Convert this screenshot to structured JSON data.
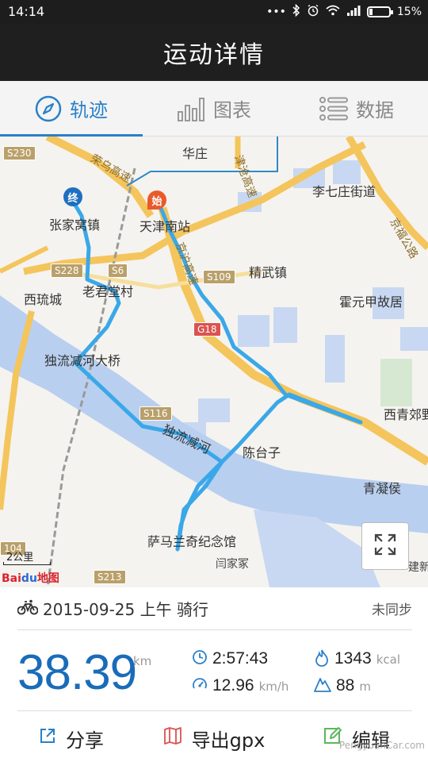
{
  "status_bar": {
    "time": "14:14",
    "dots": "•••",
    "battery_percent": "15%",
    "battery_level": 0.15
  },
  "header": {
    "title": "运动详情"
  },
  "tabs": [
    {
      "label": "轨迹",
      "icon": "compass-icon",
      "active": true
    },
    {
      "label": "图表",
      "icon": "bar-chart-icon",
      "active": false
    },
    {
      "label": "数据",
      "icon": "list-icon",
      "active": false
    }
  ],
  "map": {
    "labels": {
      "huazhuang": "华庄",
      "lqz": "李七庄街道",
      "zjw": "张家窝镇",
      "tjnz": "天津南站",
      "jwz": "精武镇",
      "xlc": "西琉城",
      "ljtc": "老君堂村",
      "hyj": "霍元甲故居",
      "dljdq": "独流减河大桥",
      "xqjy": "西青郊野",
      "dljh": "独流减河",
      "ctz": "陈台子",
      "qnh": "青凝侯",
      "smlq": "萨马兰奇纪念馆",
      "yjj": "闫家冢",
      "jx": "建新",
      "rongwu": "荣乌高速",
      "jincang": "津沧高速",
      "jinjin": "京沪高速",
      "jingwu_road": "京福公路"
    },
    "road_badges": {
      "s230": "S230",
      "s228": "S228",
      "s6": "S6",
      "s109": "S109",
      "g18": "G18",
      "s116": "S116",
      "s213": "S213",
      "s104": "104"
    },
    "markers": {
      "end": "终",
      "start": "始"
    },
    "scale": "2公里",
    "logo_bai": "Bai",
    "logo_du": "du",
    "logo_map": "地图"
  },
  "ride": {
    "date_label": "2015-09-25 上午 骑行",
    "sync_status": "未同步"
  },
  "stats": {
    "distance": "38.39",
    "distance_unit": "km",
    "duration": "2:57:43",
    "calories": "1343",
    "calories_unit": "kcal",
    "speed": "12.96",
    "speed_unit": "km/h",
    "climb": "88",
    "climb_unit": "m"
  },
  "actions": [
    {
      "label": "分享",
      "icon": "share-icon"
    },
    {
      "label": "导出gpx",
      "icon": "map-export-icon"
    },
    {
      "label": "编辑",
      "icon": "edit-icon"
    }
  ],
  "watermark": "PengyuanCar.com",
  "colors": {
    "accent": "#2a80c8",
    "route": "#3aa8e8",
    "header_bg": "#1f1f1f",
    "river": "#b9cfef",
    "highway": "#f4c55c"
  }
}
